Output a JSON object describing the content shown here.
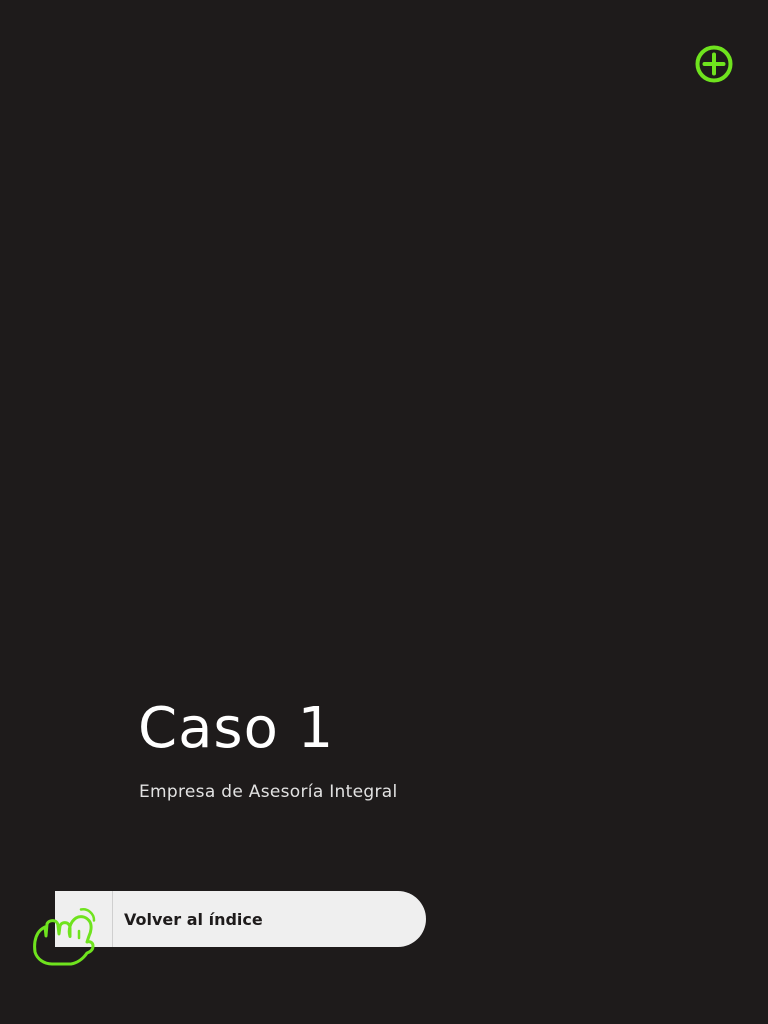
{
  "colors": {
    "background": "#1e1b1b",
    "accent": "#6fe31e",
    "button_background": "#efefef",
    "title_text": "#ffffff",
    "subtitle_text": "#e2e2e2",
    "button_text": "#1e1b1b"
  },
  "header": {
    "action_icon": "plus-circle-icon"
  },
  "main": {
    "title": "Caso 1",
    "subtitle": "Empresa de Asesoría Integral"
  },
  "footer": {
    "back_button": {
      "label": "Volver al índice",
      "icon": "pointing-hand-icon"
    }
  }
}
